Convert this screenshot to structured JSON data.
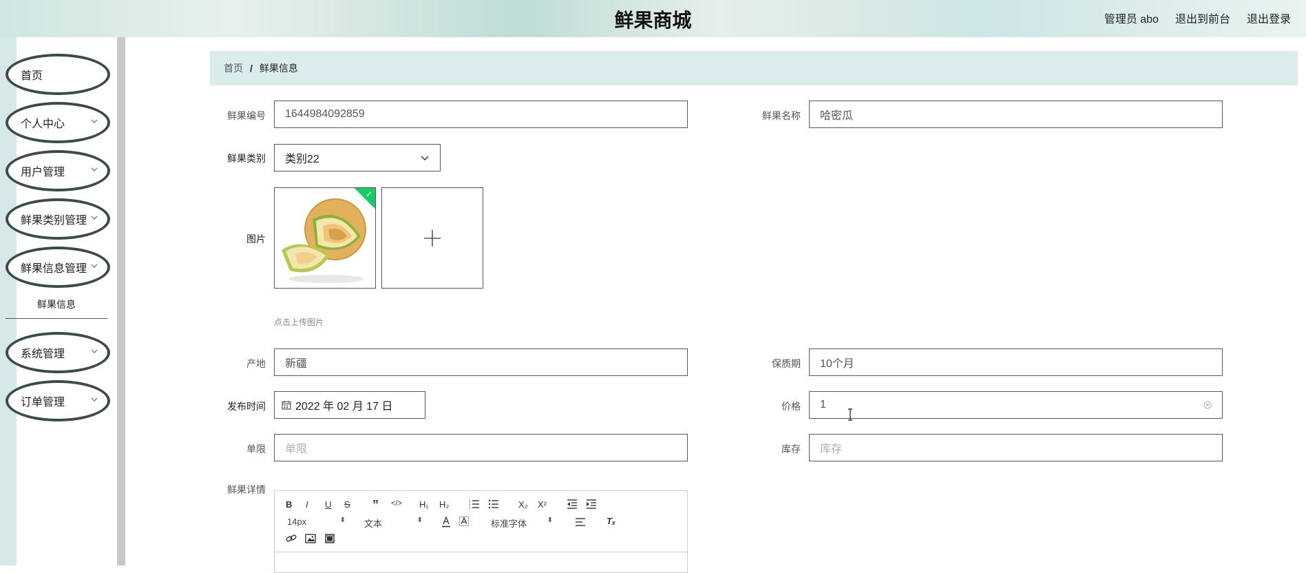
{
  "header": {
    "title": "鲜果商城",
    "admin": "管理员 abo",
    "to_front": "退出到前台",
    "logout": "退出登录"
  },
  "sidebar": {
    "items": [
      {
        "label": "首页"
      },
      {
        "label": "个人中心"
      },
      {
        "label": "用户管理"
      },
      {
        "label": "鲜果类别管理"
      },
      {
        "label": "鲜果信息管理"
      },
      {
        "label": "系统管理"
      },
      {
        "label": "订单管理"
      }
    ],
    "sub_item": "鲜果信息"
  },
  "breadcrumb": {
    "home": "首页",
    "separator": "/",
    "current": "鲜果信息"
  },
  "form": {
    "code_label": "鲜果编号",
    "code_value": "1644984092859",
    "name_label": "鲜果名称",
    "name_value": "哈密瓜",
    "category_label": "鲜果类别",
    "category_value": "类别22",
    "image_label": "图片",
    "upload_tip": "点击上传图片",
    "origin_label": "产地",
    "origin_value": "新疆",
    "shelf_label": "保质期",
    "shelf_value": "10个月",
    "publish_label": "发布时间",
    "publish_value": "2022 年 02 月 17 日",
    "price_label": "价格",
    "price_value": "1",
    "limit_label": "单限",
    "limit_placeholder": "单限",
    "stock_label": "库存",
    "stock_placeholder": "库存",
    "detail_label": "鲜果详情"
  },
  "editor": {
    "font_size": "14px",
    "text_type": "文本",
    "font_family": "标准字体",
    "buttons": {
      "bold": "B",
      "italic": "I",
      "underline": "U",
      "strike": "S",
      "quote": "”",
      "code": "</>",
      "h1": "H₁",
      "h2": "H₂",
      "sub": "X₂",
      "sup": "X²",
      "clear": "Tₓ"
    }
  },
  "colors": {
    "breadcrumb_bg": "#dbecec",
    "nav_border": "#3c4a4c",
    "success_badge": "#13ce66"
  }
}
